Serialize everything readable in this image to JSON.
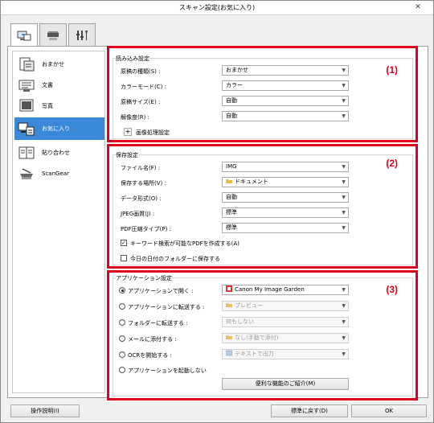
{
  "window": {
    "title": "スキャン設定(お気に入り)",
    "close_glyph": "✕"
  },
  "tabs": [
    {
      "icon": "scan-to-pc-icon"
    },
    {
      "icon": "scanner-icon"
    },
    {
      "icon": "tools-icon"
    }
  ],
  "sidebar": {
    "items": [
      {
        "label": "おまかせ",
        "icon": "auto-scan-icon",
        "selected": false
      },
      {
        "label": "文書",
        "icon": "document-icon",
        "selected": false
      },
      {
        "label": "写真",
        "icon": "photo-icon",
        "selected": false
      },
      {
        "label": "お気に入り",
        "icon": "favorite-icon",
        "selected": true
      },
      {
        "label": "貼り合わせ",
        "icon": "stitch-icon",
        "selected": false
      },
      {
        "label": "ScanGear",
        "icon": "scangear-icon",
        "selected": false
      }
    ]
  },
  "section1": {
    "number": "(1)",
    "title": "読み込み設定",
    "rows": [
      {
        "label": "原稿の種類(S) :",
        "value": "おまかせ"
      },
      {
        "label": "カラーモード(C) :",
        "value": "カラー"
      },
      {
        "label": "原稿サイズ(E) :",
        "value": "自動"
      },
      {
        "label": "解像度(R) :",
        "value": "自動"
      }
    ],
    "expander_symbol": "+",
    "expander_label": "画像処理設定"
  },
  "section2": {
    "number": "(2)",
    "title": "保存設定",
    "rows": [
      {
        "label": "ファイル名(F) :",
        "value": "IMG"
      },
      {
        "label": "保存する場所(V) :",
        "value": "ドキュメント"
      },
      {
        "label": "データ形式(O) :",
        "value": "自動"
      },
      {
        "label": "JPEG画質(J) :",
        "value": "標準"
      },
      {
        "label": "PDF圧縮タイプ(P) :",
        "value": "標準"
      }
    ],
    "check1_label": "キーワード検索が可能なPDFを作成する(A)",
    "check1_checked": true,
    "check2_label": "今日の日付のフォルダーに保存する",
    "check2_checked": false
  },
  "section3": {
    "number": "(3)",
    "title": "アプリケーション設定",
    "options": [
      {
        "label": "アプリケーションで開く :",
        "value": "Canon My Image Garden",
        "checked": true,
        "enabled": true
      },
      {
        "label": "アプリケーションに転送する :",
        "value": "プレビュー",
        "checked": false,
        "enabled": false
      },
      {
        "label": "フォルダーに転送する :",
        "value": "何もしない",
        "checked": false,
        "enabled": false
      },
      {
        "label": "メールに添付する :",
        "value": "なし(手動で添付)",
        "checked": false,
        "enabled": false
      },
      {
        "label": "OCRを開始する :",
        "value": "テキストで出力",
        "checked": false,
        "enabled": false
      },
      {
        "label": "アプリケーションを起動しない",
        "checked": false,
        "enabled": true
      }
    ],
    "more_button": "便利な機能のご紹介(M)"
  },
  "footer": {
    "help_button": "操作説明(I)",
    "defaults_button": "標準に戻す(D)",
    "ok_button": "OK",
    "resize_glyph": "⋰"
  },
  "colors": {
    "accent": "#e0001b",
    "selection": "#3a89d8"
  }
}
